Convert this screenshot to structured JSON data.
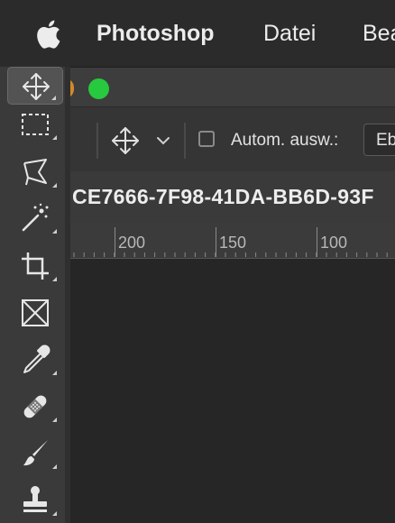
{
  "menubar": {
    "apple_icon": "apple-logo-icon",
    "app_name": "Photoshop",
    "items": [
      "Datei",
      "Bea"
    ]
  },
  "options_bar": {
    "move_icon": "move-icon",
    "chevron_icon": "chevron-down-icon",
    "auto_select_label": "Autom. ausw.:",
    "auto_select_checked": false,
    "select_value": "Eb"
  },
  "document": {
    "tab_title": "CE7666-7F98-41DA-BB6D-93F"
  },
  "ruler": {
    "labels": [
      "200",
      "150",
      "100"
    ]
  },
  "tools": [
    {
      "name": "move-tool",
      "icon": "move-icon",
      "active": true
    },
    {
      "name": "rectangular-marquee-tool",
      "icon": "marquee-icon",
      "active": false
    },
    {
      "name": "lasso-tool",
      "icon": "polygonal-lasso-icon",
      "active": false
    },
    {
      "name": "magic-wand-tool",
      "icon": "magic-wand-icon",
      "active": false
    },
    {
      "name": "crop-tool",
      "icon": "crop-icon",
      "active": false
    },
    {
      "name": "frame-tool",
      "icon": "frame-icon",
      "active": false
    },
    {
      "name": "eyedropper-tool",
      "icon": "eyedropper-icon",
      "active": false
    },
    {
      "name": "healing-brush-tool",
      "icon": "bandage-icon",
      "active": false
    },
    {
      "name": "brush-tool",
      "icon": "brush-icon",
      "active": false
    },
    {
      "name": "clone-stamp-tool",
      "icon": "stamp-icon",
      "active": false
    }
  ],
  "colors": {
    "traffic_green": "#27c93f",
    "traffic_orange": "#d3892b",
    "canvas": "#262626"
  }
}
